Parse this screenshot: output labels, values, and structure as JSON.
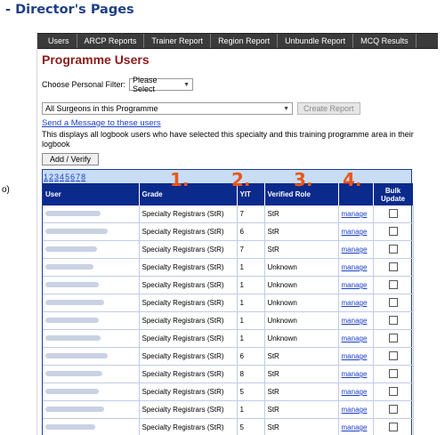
{
  "header": {
    "title": "- Director's Pages",
    "side_mark": "o)"
  },
  "nav": {
    "items": [
      {
        "label": "Users"
      },
      {
        "label": "ARCP Reports"
      },
      {
        "label": "Trainer Report"
      },
      {
        "label": "Region Report"
      },
      {
        "label": "Unbundle Report"
      },
      {
        "label": "MCQ Results"
      }
    ]
  },
  "page": {
    "title": "Programme Users",
    "filter_label": "Choose Personal Filter:",
    "filter_value": "Please Select",
    "scope_value": "All Surgeons in this Programme",
    "create_report": "Create Report",
    "send_message": "Send a Message to these users",
    "info": "This displays all logbook users who have selected this specialty and this training programme area in their logbook",
    "add_verify": "Add / Verify"
  },
  "pager": {
    "pages": [
      "1",
      "2",
      "3",
      "4",
      "5",
      "6",
      "7",
      "8"
    ]
  },
  "annotations": {
    "one": "1.",
    "two": "2.",
    "three": "3.",
    "four": "4."
  },
  "table": {
    "headers": {
      "user": "User",
      "grade": "Grade",
      "yit": "YIT",
      "role": "Verified Role",
      "action": "",
      "bulk": "Bulk Update"
    },
    "rows": [
      {
        "grade": "Specialty Registrars (StR)",
        "yit": "7",
        "role": "StR",
        "action": "manage"
      },
      {
        "grade": "Specialty Registrars (StR)",
        "yit": "6",
        "role": "StR",
        "action": "manage"
      },
      {
        "grade": "Specialty Registrars (StR)",
        "yit": "7",
        "role": "StR",
        "action": "manage"
      },
      {
        "grade": "Specialty Registrars (StR)",
        "yit": "1",
        "role": "Unknown",
        "action": "manage"
      },
      {
        "grade": "Specialty Registrars (StR)",
        "yit": "1",
        "role": "Unknown",
        "action": "manage"
      },
      {
        "grade": "Specialty Registrars (StR)",
        "yit": "1",
        "role": "Unknown",
        "action": "manage"
      },
      {
        "grade": "Specialty Registrars (StR)",
        "yit": "1",
        "role": "Unknown",
        "action": "manage"
      },
      {
        "grade": "Specialty Registrars (StR)",
        "yit": "1",
        "role": "Unknown",
        "action": "manage"
      },
      {
        "grade": "Specialty Registrars (StR)",
        "yit": "6",
        "role": "StR",
        "action": "manage"
      },
      {
        "grade": "Specialty Registrars (StR)",
        "yit": "8",
        "role": "StR",
        "action": "manage"
      },
      {
        "grade": "Specialty Registrars (StR)",
        "yit": "5",
        "role": "StR",
        "action": "manage"
      },
      {
        "grade": "Specialty Registrars (StR)",
        "yit": "1",
        "role": "StR",
        "action": "manage"
      },
      {
        "grade": "Specialty Registrars (StR)",
        "yit": "5",
        "role": "StR",
        "action": "manage"
      }
    ]
  },
  "colors": {
    "title_blue": "#1f3f86",
    "page_title_red": "#8b1a1a",
    "table_header": "#0a2a8c",
    "pager_bg": "#c8dcf4",
    "annotation_orange": "#e8571a"
  }
}
